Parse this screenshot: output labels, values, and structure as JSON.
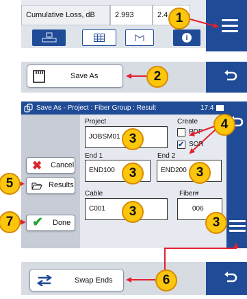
{
  "panel1": {
    "table_label": "Cumulative Loss, dB",
    "value_1": "2.993",
    "value_2": "2.4",
    "tab_icons": [
      "splice-tab-icon",
      "table-tab-icon",
      "trace-tab-icon",
      "info-tab-icon"
    ],
    "info_glyph": "i"
  },
  "panel2": {
    "save_as_label": "Save As"
  },
  "panel3": {
    "title": "Save As - Project : Fiber Group : Result",
    "clock": "17:4",
    "cancel_label": "Cancel",
    "results_label": "Results",
    "done_label": "Done",
    "project_label": "Project",
    "project_value": "JOBSM01",
    "create_label": "Create",
    "pdf_label": "PDF",
    "pdf_checked": false,
    "sor_label": "SOR",
    "sor_checked": true,
    "end1_label": "End 1",
    "end1_value": "END100",
    "end2_label": "End 2",
    "end2_value": "END200",
    "cable_label": "Cable",
    "cable_value": "C001",
    "fiber_label": "Fiber#",
    "fiber_value": "006"
  },
  "panel4": {
    "swap_label": "Swap Ends"
  },
  "callouts": {
    "c1": "1",
    "c2": "2",
    "c3": "3",
    "c4": "4",
    "c5": "5",
    "c6": "6",
    "c7": "7"
  },
  "colors": {
    "accent_blue": "#1f4b97",
    "callout_yellow": "#fcc60d",
    "arrow_red": "#e3202f",
    "cancel_red": "#d9262b",
    "done_green": "#27a33a"
  }
}
